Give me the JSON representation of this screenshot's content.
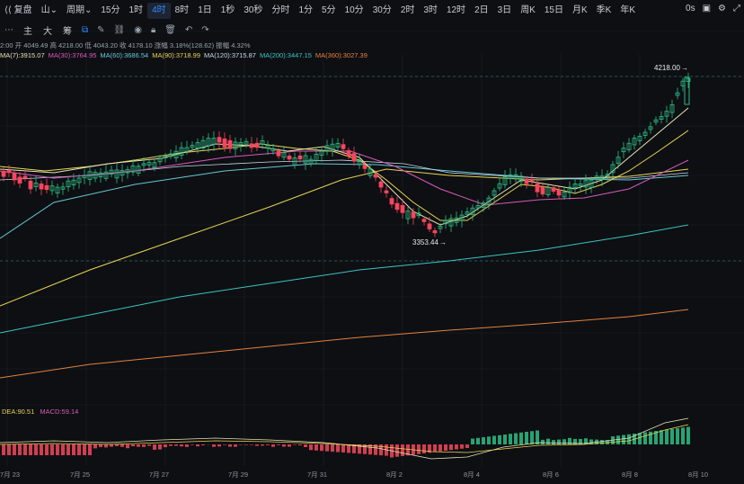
{
  "toolbar": {
    "back_label": "复盘",
    "chart_type_label": "山",
    "period_label": "周期",
    "intervals": [
      "15分",
      "1时",
      "4时",
      "8时",
      "1日",
      "1秒",
      "30秒",
      "分时",
      "1分",
      "5分",
      "10分",
      "30分",
      "2时",
      "3时",
      "12时",
      "2日",
      "3日",
      "周K",
      "15日",
      "月K",
      "季K",
      "年K"
    ],
    "active_interval": "4时",
    "right_zero": "0s"
  },
  "toolbar2": {
    "items": [
      "主",
      "大",
      "筹"
    ]
  },
  "info": {
    "text": "2:00 开 4049.49 高 4218.00 低 4043.20 收 4178.10 涨幅 3.18%(128.62) 振幅 4.32%"
  },
  "ma": [
    {
      "label": "MA(7):3915.07",
      "color": "#e8e3b3"
    },
    {
      "label": "MA(30):3764.95",
      "color": "#d95ab8"
    },
    {
      "label": "MA(60):3686.54",
      "color": "#67c7d6"
    },
    {
      "label": "MA(90):3718.99",
      "color": "#e9d552"
    },
    {
      "label": "MA(120):3715.87",
      "color": "#c9d9e9"
    },
    {
      "label": "MA(200):3447.15",
      "color": "#3cc4c4"
    },
    {
      "label": "MA(360):3027.39",
      "color": "#e8803a"
    }
  ],
  "macd": {
    "dea": "DEA:90.51",
    "macd": "MACD:59.14",
    "dea_color": "#e9d552",
    "macd_color": "#d95ab8"
  },
  "annotations": {
    "high": "4218.00",
    "low": "3353.44"
  },
  "dates": [
    "7月 23",
    "7月 25",
    "7月 27",
    "7月 29",
    "7月 31",
    "8月 2",
    "8月 4",
    "8月 6",
    "8月 8",
    "8月 10"
  ],
  "colors": {
    "up": "#2ebd85",
    "down": "#f6465d",
    "grid": "#1c2028",
    "bg": "#0d0f13"
  }
}
